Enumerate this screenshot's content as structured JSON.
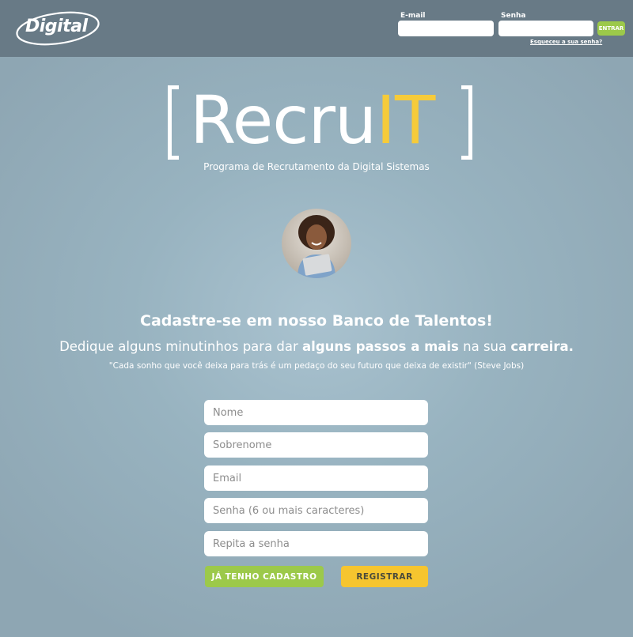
{
  "header": {
    "logo_text": "Digital",
    "email_label": "E-mail",
    "password_label": "Senha",
    "email_value": "",
    "password_value": "",
    "login_button": "ENTRAR",
    "forgot_link": "Esqueceu a sua senha?"
  },
  "brand": {
    "word_main": "Recru",
    "word_highlight": "IT",
    "subtitle": "Programa de Recrutamento da Digital Sistemas"
  },
  "hero": {
    "headline": "Cadastre-se em nosso Banco de Talentos!",
    "tagline_1": "Dedique alguns minutinhos para dar ",
    "tagline_bold_1": "alguns passos a mais",
    "tagline_2": " na sua ",
    "tagline_bold_2": "carreira.",
    "quote": "\"Cada sonho que você deixa para trás é um pedaço do seu futuro que deixa de existir\" (Steve Jobs)"
  },
  "form": {
    "first_name_placeholder": "Nome",
    "last_name_placeholder": "Sobrenome",
    "email_placeholder": "Email",
    "password_placeholder": "Senha (6 ou mais caracteres)",
    "repeat_password_placeholder": "Repita a senha",
    "already_registered_button": "JÁ TENHO CADASTRO",
    "register_button": "REGISTRAR"
  },
  "colors": {
    "accent_yellow": "#f6cb3a",
    "accent_green": "#9cc94a",
    "header_bg": "#687a86"
  }
}
